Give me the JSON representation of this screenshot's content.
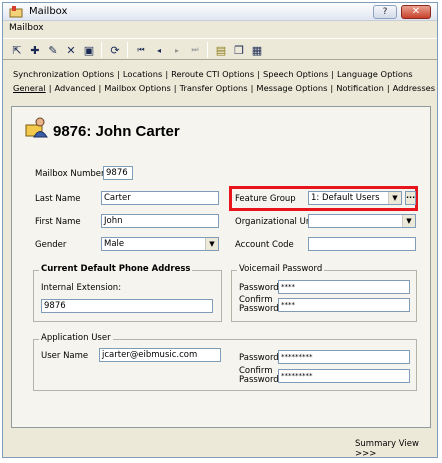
{
  "window": {
    "title": "Mailbox",
    "help_label": "?",
    "close_label": "✕"
  },
  "menubar": {
    "items": [
      "Mailbox"
    ]
  },
  "toolbar": {
    "icons": [
      "select-icon",
      "add-icon",
      "edit-icon",
      "delete-icon",
      "save-icon",
      "refresh-icon",
      "first-record-icon",
      "previous-record-icon",
      "next-record-icon",
      "last-record-icon",
      "note-icon",
      "copy-icon",
      "grid-icon"
    ]
  },
  "tabs": {
    "row1": [
      "Synchronization Options",
      "Locations",
      "Reroute CTI Options",
      "Speech Options",
      "Language Options"
    ],
    "row2": [
      "General",
      "Advanced",
      "Mailbox Options",
      "Transfer Options",
      "Message Options",
      "Notification",
      "Addresses"
    ]
  },
  "heading": "9876: John Carter",
  "form": {
    "mailbox_number_label": "Mailbox Number",
    "mailbox_number": "9876",
    "last_name_label": "Last Name",
    "last_name": "Carter",
    "first_name_label": "First Name",
    "first_name": "John",
    "gender_label": "Gender",
    "gender": "Male",
    "feature_group_label": "Feature Group",
    "feature_group": "1: Default Users",
    "feature_group_more": "...",
    "org_unit_label": "Organizational Unit",
    "org_unit": "",
    "account_code_label": "Account Code",
    "account_code": ""
  },
  "phone_address": {
    "title": "Current Default Phone Address",
    "internal_ext_label": "Internal Extension:",
    "internal_ext": "9876"
  },
  "voicemail_password": {
    "title": "Voicemail Password",
    "password_label": "Password",
    "password": "****",
    "confirm_label_1": "Confirm",
    "confirm_label_2": "Password",
    "confirm": "****"
  },
  "application_user": {
    "title": "Application User",
    "user_name_label": "User Name",
    "user_name": "jcarter@eibmusic.com",
    "password_label": "Password",
    "password": "*********",
    "confirm_label_1": "Confirm",
    "confirm_label_2": "Password",
    "confirm": "*********"
  },
  "footer": {
    "summary_view": "Summary View >>>"
  },
  "colors": {
    "highlight": "#e8141b",
    "border": "#7f9db9",
    "window_bg": "#ece9d8"
  }
}
